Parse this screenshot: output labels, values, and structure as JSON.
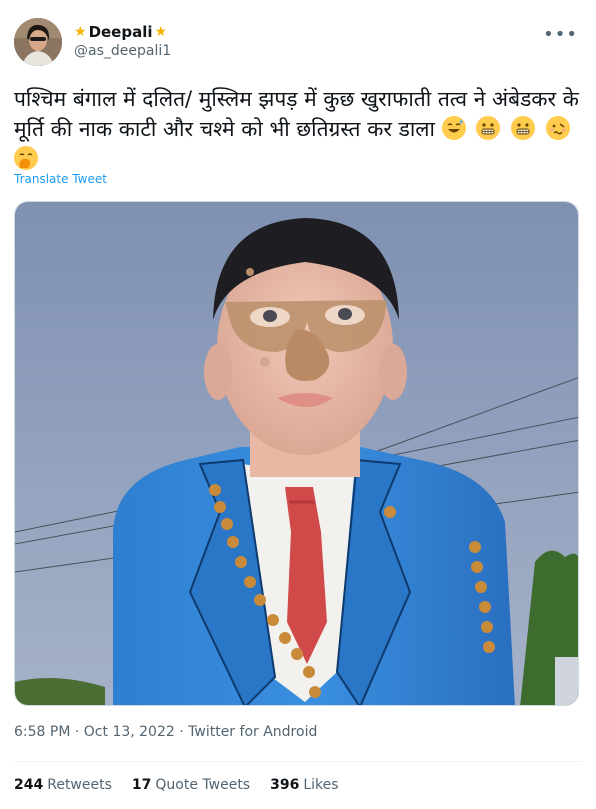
{
  "author": {
    "display_name": "Deepali",
    "handle": "@as_deepali1",
    "badge_icon": "star-emoji-icon"
  },
  "more_label": "•••",
  "tweet": {
    "text": "पश्चिम बंगाल में दलित/ मुस्लिम झपड़ में कुछ खुराफाती तत्व ने अंबेडकर के मूर्ति की नाक काटी और चश्मे को भी छतिग्रस्त कर डाला",
    "emojis": [
      "sweat-smile-emoji-icon",
      "grimace-emoji-icon",
      "grimace-emoji-icon",
      "woozy-face-emoji-icon",
      "hand-over-mouth-emoji-icon"
    ],
    "translate_label": "Translate Tweet"
  },
  "meta": {
    "time": "6:58 PM",
    "date": "Oct 13, 2022",
    "source": "Twitter for Android",
    "separator": "·"
  },
  "stats": {
    "retweets_count": "244",
    "retweets_label": "Retweets",
    "quotes_count": "17",
    "quotes_label": "Quote Tweets",
    "likes_count": "396",
    "likes_label": "Likes"
  },
  "colors": {
    "link": "#1d9bf0",
    "secondary_text": "#536471",
    "primary_text": "#0f1419"
  }
}
